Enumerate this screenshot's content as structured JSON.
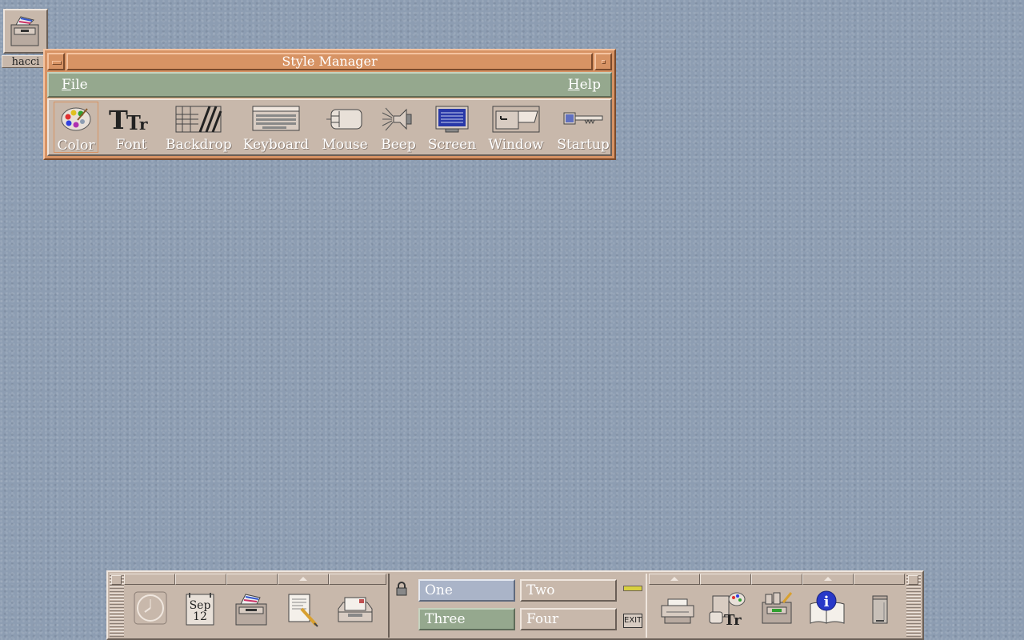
{
  "desktop": {
    "icon_label": "hacci"
  },
  "window": {
    "title": "Style Manager",
    "menus": [
      {
        "label": "File",
        "mnemonic": "F",
        "rest": "ile"
      },
      {
        "label": "Help",
        "mnemonic": "H",
        "rest": "elp"
      }
    ],
    "tools": [
      {
        "label": "Color",
        "icon": "palette-icon",
        "selected": true
      },
      {
        "label": "Font",
        "icon": "font-icon"
      },
      {
        "label": "Backdrop",
        "icon": "backdrop-icon"
      },
      {
        "label": "Keyboard",
        "icon": "keyboard-icon"
      },
      {
        "label": "Mouse",
        "icon": "mouse-icon"
      },
      {
        "label": "Beep",
        "icon": "speaker-icon"
      },
      {
        "label": "Screen",
        "icon": "monitor-icon"
      },
      {
        "label": "Window",
        "icon": "window-icon"
      },
      {
        "label": "Startup",
        "icon": "key-icon"
      }
    ]
  },
  "front_panel": {
    "calendar": {
      "month": "Sep",
      "day": "12"
    },
    "workspaces": [
      {
        "label": "One",
        "active": true
      },
      {
        "label": "Two"
      },
      {
        "label": "Three"
      },
      {
        "label": "Four"
      }
    ],
    "exit_label": "EXIT",
    "left_icons": [
      "clock-icon",
      "calendar-icon",
      "file-manager-icon",
      "text-editor-icon",
      "mail-icon"
    ],
    "right_icons": [
      "printer-icon",
      "style-manager-icon",
      "application-manager-icon",
      "help-icon",
      "trash-icon"
    ]
  },
  "colors": {
    "titlebar": "#d79364",
    "menubar": "#95a88e",
    "panel": "#c8b8ab",
    "desktop": "#8d9db2",
    "active_workspace": "#aab4c8"
  }
}
